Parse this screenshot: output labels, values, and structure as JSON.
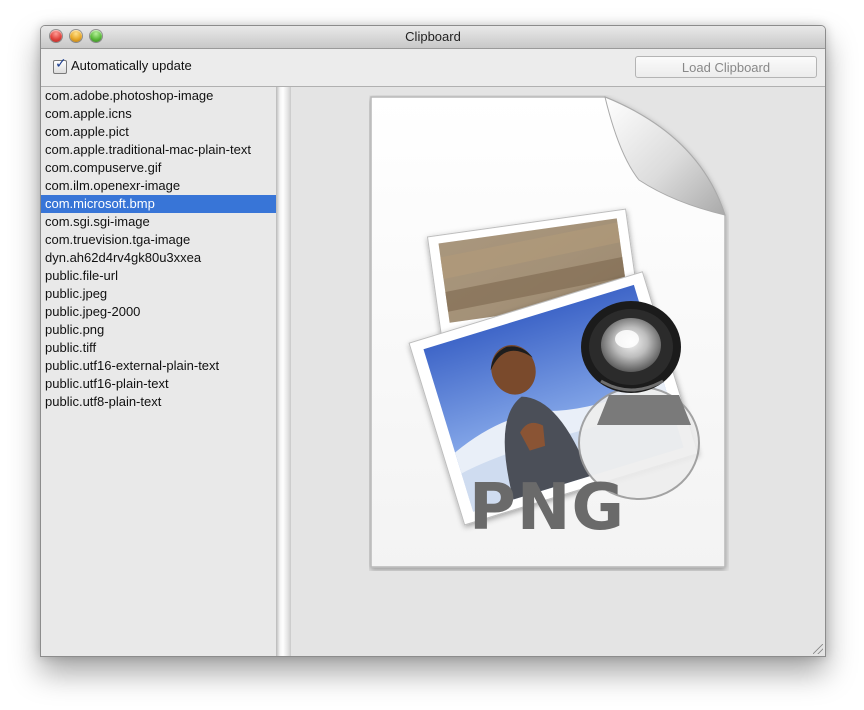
{
  "window": {
    "title": "Clipboard"
  },
  "toolbar": {
    "auto_update_label": "Automatically update",
    "auto_update_checked": true,
    "load_button_label": "Load Clipboard"
  },
  "type_list": {
    "selected_index": 6,
    "items": [
      "com.adobe.photoshop-image",
      "com.apple.icns",
      "com.apple.pict",
      "com.apple.traditional-mac-plain-text",
      "com.compuserve.gif",
      "com.ilm.openexr-image",
      "com.microsoft.bmp",
      "com.sgi.sgi-image",
      "com.truevision.tga-image",
      "dyn.ah62d4rv4gk80u3xxea",
      "public.file-url",
      "public.jpeg",
      "public.jpeg-2000",
      "public.png",
      "public.tiff",
      "public.utf16-external-plain-text",
      "public.utf16-plain-text",
      "public.utf8-plain-text"
    ]
  },
  "preview": {
    "icon": "png-document-icon",
    "format_label": "PNG"
  },
  "colors": {
    "selection": "#3875d7",
    "close": "#e0443e",
    "minimize": "#e8a92a",
    "zoom": "#5cba3c"
  }
}
